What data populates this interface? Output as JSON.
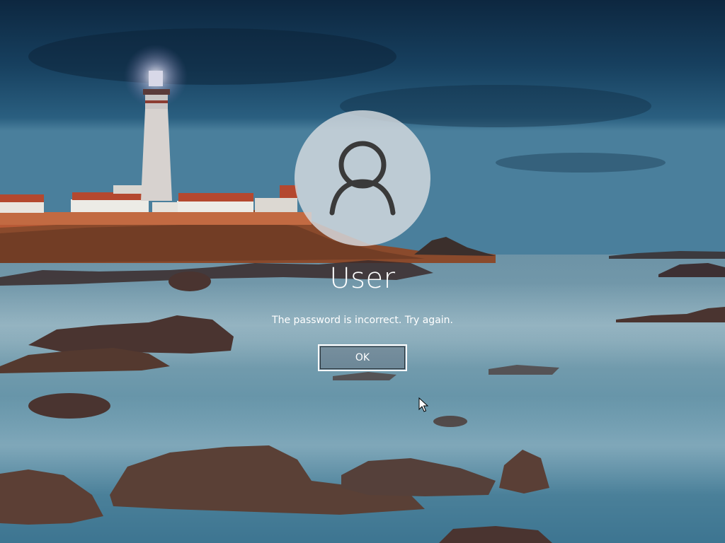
{
  "lock_screen": {
    "user_name": "User",
    "error_message": "The password is incorrect. Try again.",
    "ok_button_label": "OK"
  },
  "icons": {
    "avatar": "user-avatar-icon",
    "cursor": "mouse-pointer-icon"
  },
  "colors": {
    "text": "#ffffff",
    "avatar_circle": "#d7dce0",
    "button_border": "#ffffff"
  }
}
